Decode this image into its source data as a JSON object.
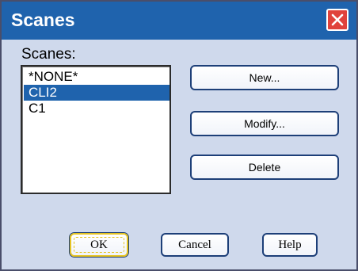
{
  "window": {
    "title": "Scanes",
    "close_icon": "close-icon"
  },
  "scanes_list": {
    "label": "Scanes:",
    "items": [
      {
        "text": "*NONE*",
        "selected": false
      },
      {
        "text": "CLI2",
        "selected": true
      },
      {
        "text": "C1",
        "selected": false
      }
    ]
  },
  "side_buttons": {
    "new_label": "New...",
    "modify_label": "Modify...",
    "delete_label": "Delete"
  },
  "bottom_buttons": {
    "ok_label": "OK",
    "cancel_label": "Cancel",
    "help_label": "Help"
  },
  "colors": {
    "titlebar": "#1f63ad",
    "dialog_bg": "#cfd9ec",
    "selection": "#1f63ad",
    "close_button": "#e0423b",
    "focus_ring": "#e5c423"
  }
}
